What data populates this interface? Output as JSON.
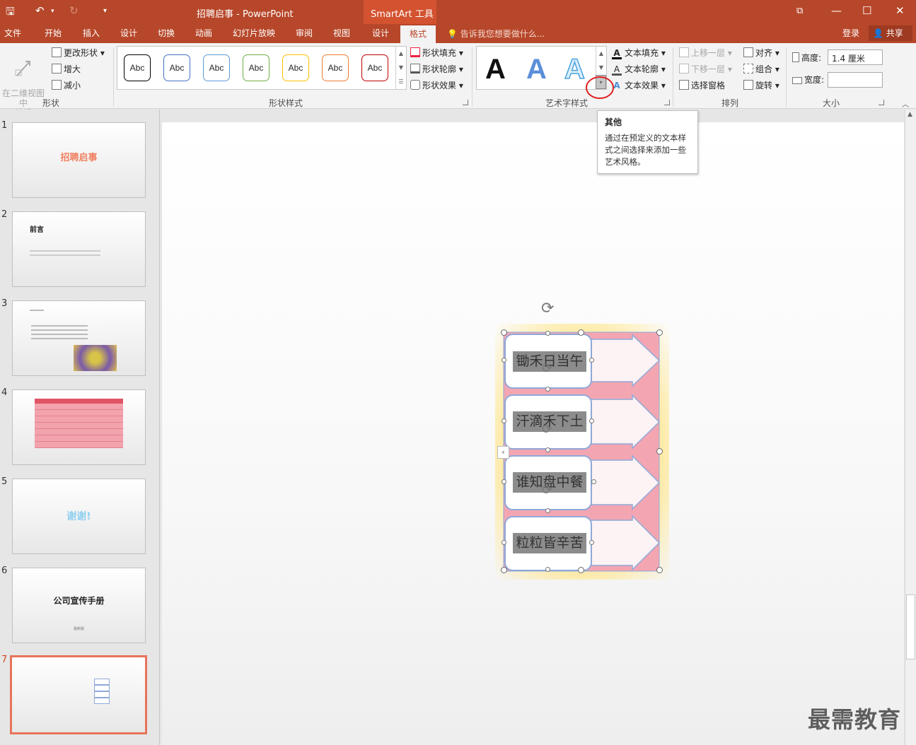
{
  "titlebar": {
    "title": "招聘启事 - PowerPoint",
    "context_group": "SmartArt 工具",
    "undo_icon": "↶",
    "redo_icon": "↻",
    "save_icon": "🖫",
    "customize_icon": "▾",
    "restore_icon": "⧉",
    "minimize_icon": "—",
    "maximize_icon": "☐",
    "close_icon": "✕"
  },
  "tabs": [
    "文件",
    "开始",
    "插入",
    "设计",
    "切换",
    "动画",
    "幻灯片放映",
    "审阅",
    "视图",
    "设计",
    "格式"
  ],
  "tellme": "告诉我您想要做什么...",
  "login": "登录",
  "share": "共享",
  "ribbon": {
    "shapes_group": {
      "label": "形状",
      "edit_2d": "在二维视图中\n编辑",
      "change_shape": "更改形状",
      "larger": "增大",
      "smaller": "减小"
    },
    "shape_styles_group": {
      "label": "形状样式",
      "gallery": [
        "Abc",
        "Abc",
        "Abc",
        "Abc",
        "Abc",
        "Abc",
        "Abc"
      ],
      "gallery_colors": [
        "#000000",
        "#4472c4",
        "#5b9bd5",
        "#70ad47",
        "#ffc000",
        "#ed7d31",
        "#c00000"
      ],
      "fill": "形状填充",
      "outline": "形状轮廓",
      "effects": "形状效果"
    },
    "wordart_group": {
      "label": "艺术字样式",
      "letter": "A",
      "text_fill": "文本填充",
      "text_outline": "文本轮廓",
      "text_effects": "文本效果"
    },
    "arrange_group": {
      "label": "排列",
      "bring_forward": "上移一层",
      "send_backward": "下移一层",
      "selection_pane": "选择窗格",
      "align": "对齐",
      "group": "组合",
      "rotate": "旋转"
    },
    "size_group": {
      "label": "大小",
      "height_label": "高度:",
      "height_value": "1.4 厘米",
      "width_label": "宽度:",
      "width_value": ""
    }
  },
  "tooltip": {
    "title": "其他",
    "body": "通过在预定义的文本样式之间选择来添加一些艺术风格。"
  },
  "slides": [
    {
      "num": "1",
      "title": "招聘启事"
    },
    {
      "num": "2",
      "title": "前言"
    },
    {
      "num": "3",
      "title": ""
    },
    {
      "num": "4",
      "title": ""
    },
    {
      "num": "5",
      "title": "谢谢!"
    },
    {
      "num": "6",
      "title": "公司宣传手册",
      "subtitle": "最新版"
    },
    {
      "num": "7",
      "title": ""
    }
  ],
  "smartart": {
    "nodes": [
      "锄禾日当午",
      "汗滴禾下土",
      "谁知盘中餐",
      "粒粒皆辛苦"
    ]
  },
  "watermark": "最需教育"
}
